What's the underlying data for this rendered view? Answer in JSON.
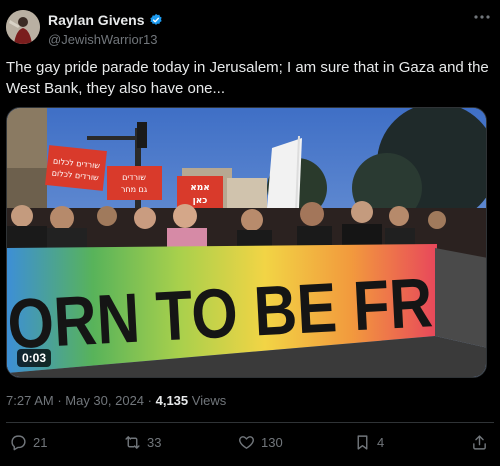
{
  "author": {
    "display_name": "Raylan Givens",
    "handle": "@JewishWarrior13",
    "verified": true
  },
  "tweet": {
    "text": "The gay pride parade today in Jerusalem; I am sure that in Gaza and the West Bank, they also have one..."
  },
  "media": {
    "duration": "0:03",
    "banner_text": "ORN TO BE FREE",
    "signs": [
      "שורדים לכלום",
      "שורדים לכלום",
      "שורדים",
      "גם מחר",
      "אמא",
      "כאן"
    ]
  },
  "meta": {
    "time": "7:27 AM",
    "separator": " · ",
    "date": "May 30, 2024",
    "views_count": "4,135",
    "views_label": " Views"
  },
  "actions": {
    "replies": "21",
    "retweets": "33",
    "likes": "130",
    "bookmarks": "4"
  },
  "icons": {
    "more": "more-icon",
    "reply": "reply-icon",
    "retweet": "retweet-icon",
    "like": "heart-icon",
    "bookmark": "bookmark-icon",
    "share": "share-icon",
    "verified": "verified-badge-icon"
  },
  "colors": {
    "background": "#000000",
    "text": "#e7e9ea",
    "muted": "#71767b",
    "verified": "#1d9bf0"
  }
}
